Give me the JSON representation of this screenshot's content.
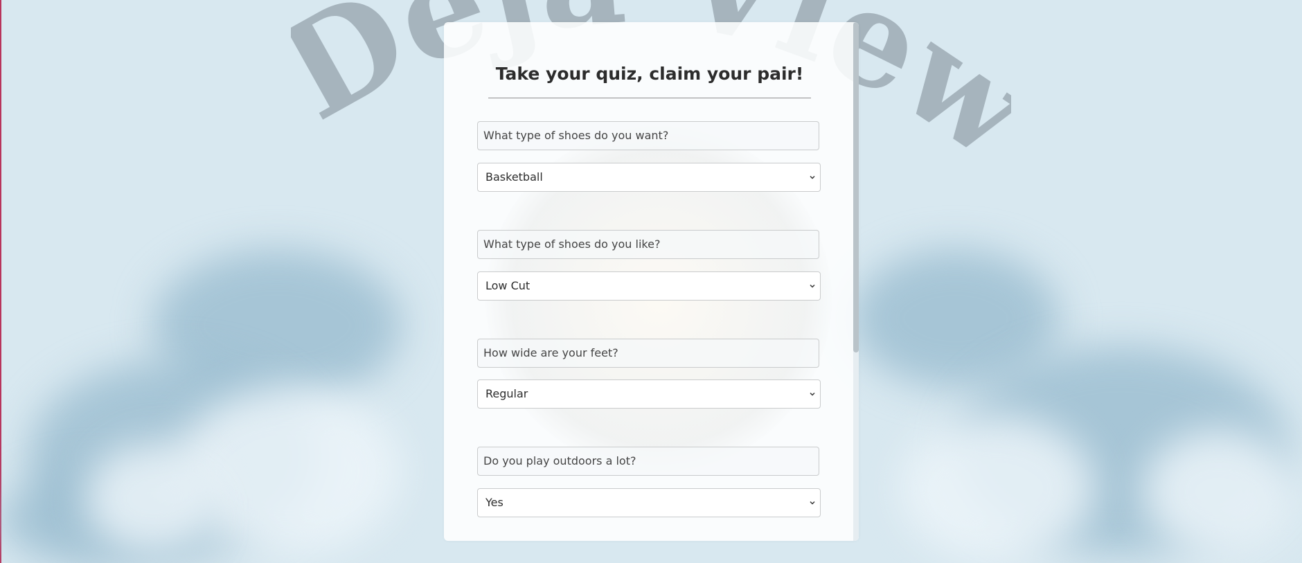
{
  "watermark": {
    "text": "Deja-View"
  },
  "quiz": {
    "title": "Take your quiz, claim your pair!",
    "questions": [
      {
        "label": "What type of shoes do you want?",
        "answer": "Basketball"
      },
      {
        "label": "What type of shoes do you like?",
        "answer": "Low Cut"
      },
      {
        "label": "How wide are your feet?",
        "answer": "Regular"
      },
      {
        "label": "Do you play outdoors a lot?",
        "answer": "Yes"
      }
    ]
  },
  "icons": {
    "dropdown": "chevron-down-icon"
  },
  "colors": {
    "background": "#d8e8f0",
    "card": "#ffffff",
    "watermark": "#a6b4bd",
    "left_edge": "#b8345c"
  }
}
